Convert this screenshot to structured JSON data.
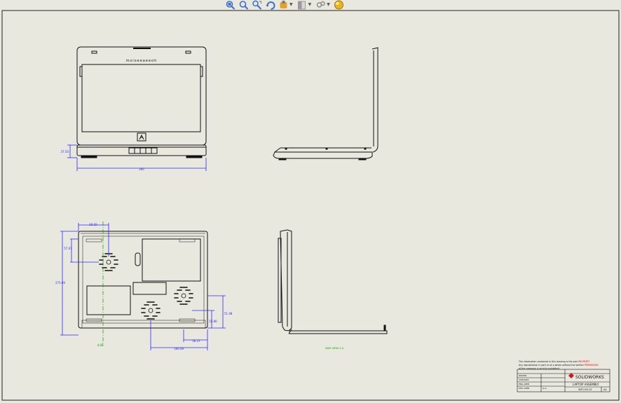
{
  "toolbar": {
    "buttons": [
      {
        "name": "zoom-to-fit-icon",
        "color": "#3a6fd0"
      },
      {
        "name": "zoom-to-area-icon",
        "color": "#3a6fd0"
      },
      {
        "name": "zoom-in-out-icon",
        "color": "#3a6fd0"
      },
      {
        "name": "rotate-icon",
        "color": "#3a6fd0"
      },
      {
        "name": "pan-icon",
        "color": "#e5a12b"
      },
      {
        "name": "display-style-icon",
        "color": "#9a9a9a"
      },
      {
        "name": "view-settings-icon",
        "color": "#8a8a8a"
      },
      {
        "name": "appearance-icon",
        "color": "#e8b419"
      }
    ]
  },
  "views": {
    "front": {
      "width_dim": "395",
      "height_dim": "37.50"
    },
    "back": {
      "top_dim": "20.50",
      "left_dim": "57.07",
      "height_dim": "275.00",
      "right_dim_1": "51.48",
      "right_dim_2": "55.80",
      "bottom_dim_1": "56.37",
      "bottom_dim_2": "180.48",
      "center_dim": "4.00"
    },
    "side_label": "SIDE VIEW 1:4"
  },
  "notes": {
    "line1": "The information contained in this drawing is the sole",
    "line1_red": "PROPERTY",
    "line2": "Any reproduction in part or as a whole without the written",
    "line2_red": "PERMISSION",
    "line3": "of the company is strictly prohibited."
  },
  "title_block": {
    "brand": "SOLIDWORKS",
    "title": "LAPTOP ASSEMBLY",
    "drawing_no": "SMT-00113",
    "sheet": "A4",
    "rows": [
      "DRAWN",
      "CHECKED",
      "ENG APPR",
      "MFG APPR",
      "Q.A."
    ]
  },
  "bezel_logo": "msioeeaeeoh",
  "colors": {
    "dim": "#2a2aff",
    "center": "#00a000",
    "line": "#000000",
    "note_red": "#e00000"
  }
}
